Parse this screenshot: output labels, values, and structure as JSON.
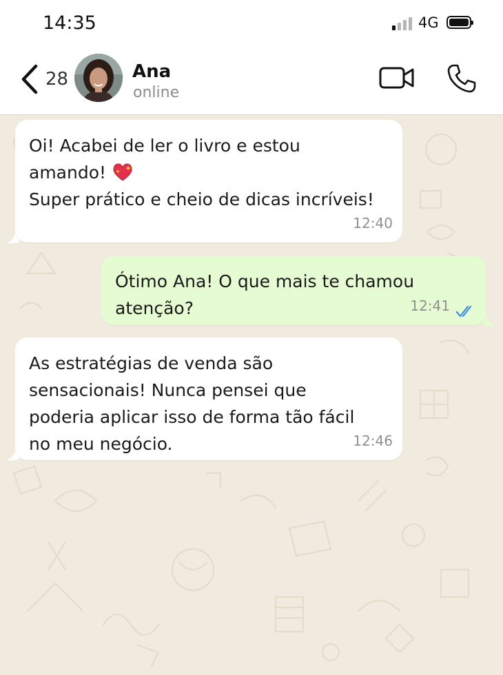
{
  "status_bar": {
    "time": "14:35",
    "network": "4G",
    "signal_icon": "signal-bars-icon",
    "battery_icon": "battery-icon"
  },
  "header": {
    "back_icon": "chevron-left-icon",
    "unread_count": "28",
    "contact_name": "Ana",
    "contact_status": "online",
    "video_icon": "video-camera-icon",
    "call_icon": "phone-icon"
  },
  "messages": [
    {
      "direction": "incoming",
      "text_part1": "Oi! Acabei de ler o livro e estou\namando! ",
      "emoji": "sparkling-heart-icon",
      "text_part2": "Super prático e cheio de dicas incríveis!",
      "time": "12:40"
    },
    {
      "direction": "outgoing",
      "text": "Ótimo Ana! O que mais te chamou\natenção?",
      "time": "12:41",
      "status_icon": "double-check-read-icon"
    },
    {
      "direction": "incoming",
      "text": "As estratégias de venda são\nsensacionais! Nunca pensei que\npoderia aplicar isso de forma tão fácil\nno meu negócio.",
      "time": "12:46"
    }
  ],
  "colors": {
    "incoming_bubble": "#ffffff",
    "outgoing_bubble": "#e5fbd2",
    "wallpaper": "#f1ebdf",
    "read_ticks": "#3a8ee6"
  }
}
